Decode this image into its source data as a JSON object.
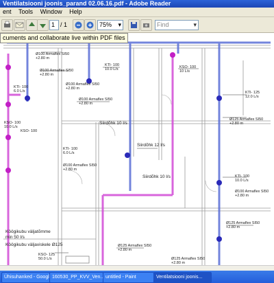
{
  "window": {
    "title": "Ventilatsiooni joonis_parand 02.06.16.pdf - Adobe Reader"
  },
  "menu": [
    "ent",
    "Tools",
    "Window",
    "Help"
  ],
  "toolbar": {
    "page_current": "1",
    "page_total": "/ 1",
    "zoom": "75%",
    "find_placeholder": "Find"
  },
  "banner": {
    "text": "cuments and collaborate live within PDF files"
  },
  "drawing_labels": [
    "Ø100 Armaflex SI50",
    "+2.80 m",
    "Ø100 Armaflex SI50",
    "+2.80 m",
    "KTI- 100",
    "6.0 L/s",
    "Ø100 Armaflex SI50",
    "+2.80 m",
    "KTI- 100",
    "10.0 L/s",
    "KSO- 100",
    "10 L/s",
    "Ø100 Armaflex SI50",
    "+2.80 m",
    "Siirdõhk 10 l/s",
    "KTI- 125",
    "12.0 L/s",
    "Ø125 Armaflex SI50",
    "+2.80 m",
    "KSO- 100",
    "10.0 L/s",
    "KTI- 100",
    "6.0 L/s",
    "Siirdõhk 12 l/s",
    "Ø100 Armaflex SI50",
    "+2.80 m",
    "Siirdõhk 10 l/s",
    "KTI- 100",
    "10.0 L/s",
    "Ø100 Armaflex SI50",
    "+2.80 m",
    "Köögikubu väljatõmme",
    "min 50 l/s",
    "Köögikubu väljaviskele Ø125",
    "KSO- 125",
    "50.0 L/s",
    "Ø125 Armaflex SI50",
    "+2.80 m",
    "Ø125 Armaflex SI50",
    "+2.80 m",
    "Ø125 Armaflex SI50",
    "+2.80 m",
    "KSO- 100"
  ],
  "taskbar": {
    "items": [
      "Ühisuhanked - Googl...",
      "160530_PP_KVV_Ven...",
      "untitled - Paint",
      "Ventilatsiooni joonis..."
    ]
  }
}
